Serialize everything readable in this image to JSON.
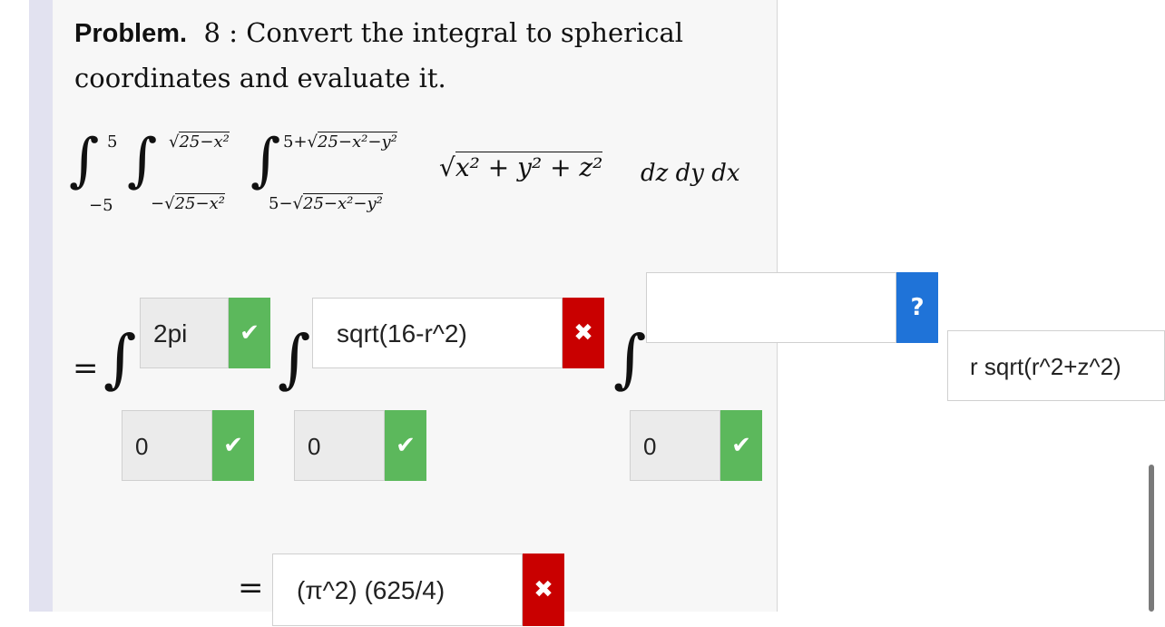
{
  "problem": {
    "label": "Problem.",
    "number": "8 :",
    "text": "Convert the integral to spherical coordinates and evaluate it."
  },
  "integral": {
    "outer_upper": "5",
    "outer_lower": "−5",
    "middle_upper": "25−x²",
    "middle_lower_prefix": "−",
    "middle_lower": "25−x²",
    "inner_upper_prefix": "5+",
    "inner_upper": "25−x²−y²",
    "inner_lower_prefix": "5−",
    "inner_lower": "25−x²−y²",
    "integrand": "x² + y² + z²",
    "differentials": "dz dy dx"
  },
  "answers": {
    "outer_upper": "2pi",
    "outer_lower": "0",
    "middle_upper": "sqrt(16-r^2)",
    "middle_lower": "0",
    "inner_upper": "",
    "inner_lower": "0",
    "integrand": "r sqrt(r^2+z^2)",
    "result": "(π^2) (625/4)"
  },
  "icons": {
    "correct": "check-icon",
    "incorrect": "x-icon",
    "help": "question-icon"
  },
  "colors": {
    "correct": "#5cb85c",
    "incorrect": "#c90000",
    "help": "#1f73d8"
  }
}
